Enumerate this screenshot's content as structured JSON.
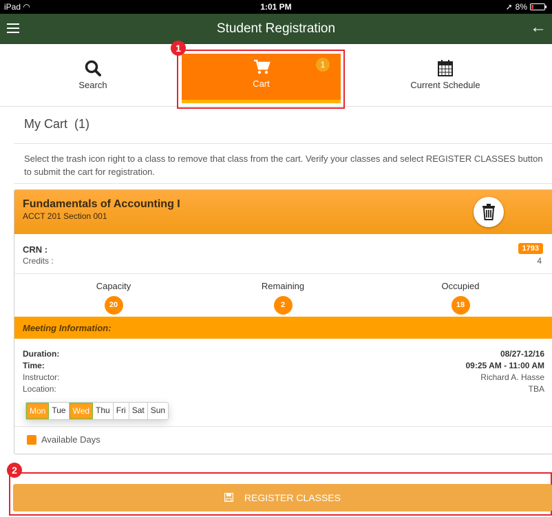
{
  "status_bar": {
    "device": "iPad",
    "time": "1:01 PM",
    "battery": "8%"
  },
  "header": {
    "title": "Student Registration"
  },
  "tabs": [
    {
      "label": "Search",
      "icon": "search-icon"
    },
    {
      "label": "Cart",
      "icon": "cart-icon",
      "badge": "1"
    },
    {
      "label": "Current Schedule",
      "icon": "calendar-icon"
    }
  ],
  "annotations": {
    "one": "1",
    "two": "2"
  },
  "page": {
    "title": "My Cart",
    "count": "(1)",
    "instructions": "Select the trash icon right to a class to remove that class from the cart. Verify your classes and select REGISTER CLASSES button to submit the cart for registration."
  },
  "course": {
    "name": "Fundamentals of Accounting I",
    "code": "ACCT 201 Section 001",
    "crn_label": "CRN :",
    "crn": "1793",
    "credits_label": "Credits :",
    "credits": "4",
    "capacity_label": "Capacity",
    "capacity": "20",
    "remaining_label": "Remaining",
    "remaining": "2",
    "occupied_label": "Occupied",
    "occupied": "18",
    "meeting_header": "Meeting Information:",
    "duration_label": "Duration:",
    "duration": "08/27-12/16",
    "time_label": "Time:",
    "time": "09:25 AM - 11:00 AM",
    "instructor_label": "Instructor:",
    "instructor": "Richard A. Hasse",
    "location_label": "Location:",
    "location": "TBA",
    "days": [
      {
        "label": "Mon",
        "active": true
      },
      {
        "label": "Tue",
        "active": false
      },
      {
        "label": "Wed",
        "active": true
      },
      {
        "label": "Thu",
        "active": false
      },
      {
        "label": "Fri",
        "active": false
      },
      {
        "label": "Sat",
        "active": false
      },
      {
        "label": "Sun",
        "active": false
      }
    ],
    "legend": "Available Days"
  },
  "register_button": {
    "label": "REGISTER CLASSES"
  },
  "colors": {
    "header": "#2f4f2f",
    "accent": "#ff7a00",
    "annotation": "#e8232c",
    "register": "#f0a945"
  }
}
